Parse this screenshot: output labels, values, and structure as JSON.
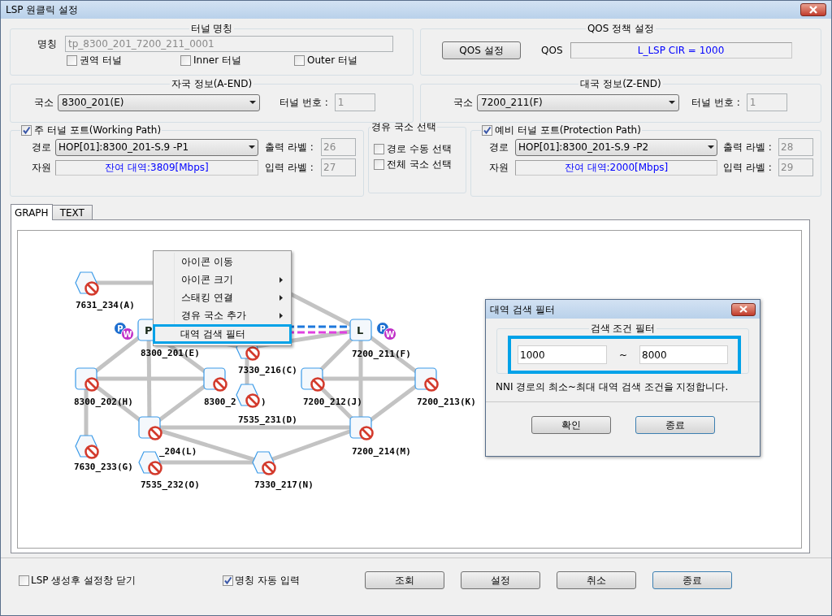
{
  "window": {
    "title": "LSP 원클릭 설정"
  },
  "tunnel_name": {
    "title": "터널 명칭",
    "label": "명칭",
    "value": "tp_8300_201_7200_211_0001",
    "options": [
      {
        "label": "권역 터널",
        "checked": false
      },
      {
        "label": "Inner 터널",
        "checked": false
      },
      {
        "label": "Outer 터널",
        "checked": false
      }
    ]
  },
  "qos": {
    "title": "QOS 정책 설정",
    "button": "QOS 설정",
    "label": "QOS",
    "value": "L_LSP CIR = 1000"
  },
  "a_end": {
    "title": "자국 정보(A-END)",
    "station_label": "국소",
    "station": "8300_201(E)",
    "tunnel_no_label": "터널 번호 :",
    "tunnel_no": "1"
  },
  "z_end": {
    "title": "대국 정보(Z-END)",
    "station_label": "국소",
    "station": "7200_211(F)",
    "tunnel_no_label": "터널 번호 :",
    "tunnel_no": "1"
  },
  "working": {
    "title": "주 터널 포트(Working Path)",
    "checked": true,
    "path_label": "경로",
    "path": "HOP[01]:8300_201-S.9 -P1",
    "resource_label": "자원",
    "resource": "잔여 대역:3809[Mbps]",
    "out_label": "출력 라벨 :",
    "out": "26",
    "in_label": "입력 라벨 :",
    "in": "27"
  },
  "via": {
    "title": "경유 국소 선택",
    "options": [
      {
        "label": "경로 수동 선택",
        "checked": false
      },
      {
        "label": "전체 국소 선택",
        "checked": false
      }
    ]
  },
  "protection": {
    "title": "예비 터널 포트(Protection Path)",
    "checked": true,
    "path_label": "경로",
    "path": "HOP[01]:8300_201-S.9 -P2",
    "resource_label": "자원",
    "resource": "잔여 대역:2000[Mbps]",
    "out_label": "출력 라벨 :",
    "out": "28",
    "in_label": "입력 라벨 :",
    "in": "29"
  },
  "tabs": [
    {
      "label": "GRAPH",
      "selected": true
    },
    {
      "label": "TEXT",
      "selected": false
    }
  ],
  "graph": {
    "nodes": [
      {
        "label": "7631_234(A)",
        "kind": "hexagon",
        "blocked": true
      },
      {
        "label": "8300_201(E)",
        "letter": "P",
        "kind": "square",
        "blocked": false,
        "badges": [
          "P",
          "W"
        ]
      },
      {
        "label": "7330_216(C)",
        "kind": "hexagon",
        "blocked": true
      },
      {
        "label": "7200_211(F)",
        "letter": "L",
        "kind": "square",
        "blocked": false,
        "badges": [
          "P",
          "W"
        ]
      },
      {
        "label": "8300_202(H)",
        "kind": "square",
        "blocked": true
      },
      {
        "label": "8300_2",
        "label_tail": ")",
        "kind": "square",
        "blocked": true
      },
      {
        "label": "7535_231(D)",
        "kind": "hexagon",
        "blocked": true
      },
      {
        "label": "7200_212(J)",
        "kind": "square",
        "blocked": true
      },
      {
        "label": "7200_213(K)",
        "kind": "square",
        "blocked": true
      },
      {
        "label": "_204(L)",
        "kind": "square",
        "blocked": true
      },
      {
        "label": "7200_214(M)",
        "kind": "square",
        "blocked": true
      },
      {
        "label": "7630_233(G)",
        "kind": "hexagon",
        "blocked": true
      },
      {
        "label": "7535_232(O)",
        "kind": "hexagon",
        "blocked": true
      },
      {
        "label": "7330_217(N)",
        "kind": "hexagon",
        "blocked": true
      }
    ]
  },
  "context_menu": {
    "items": [
      {
        "label": "아이콘 이동",
        "submenu": false,
        "selected": false
      },
      {
        "label": "아이콘 크기",
        "submenu": true,
        "selected": false
      },
      {
        "label": "스태킹 연결",
        "submenu": true,
        "selected": false
      },
      {
        "label": "경유 국소 추가",
        "submenu": true,
        "selected": false
      },
      {
        "label": "대역 검색 필터",
        "submenu": false,
        "selected": true
      }
    ]
  },
  "dialog": {
    "title": "대역 검색 필터",
    "group": "검색 조건 필터",
    "min": "1000",
    "separator": "~",
    "max": "8000",
    "hint": "NNI 경로의 최소~최대 대역 검색 조건을 지정합니다.",
    "buttons": [
      {
        "label": "확인",
        "default": false
      },
      {
        "label": "종료",
        "default": true
      }
    ]
  },
  "footer": {
    "options": [
      {
        "label": "LSP 생성후 설정창 닫기",
        "checked": false
      },
      {
        "label": "명칭 자동 입력",
        "checked": true
      }
    ],
    "buttons": [
      {
        "label": "조회",
        "default": false
      },
      {
        "label": "설정",
        "default": false
      },
      {
        "label": "취소",
        "default": false
      },
      {
        "label": "종료",
        "default": true
      }
    ]
  }
}
